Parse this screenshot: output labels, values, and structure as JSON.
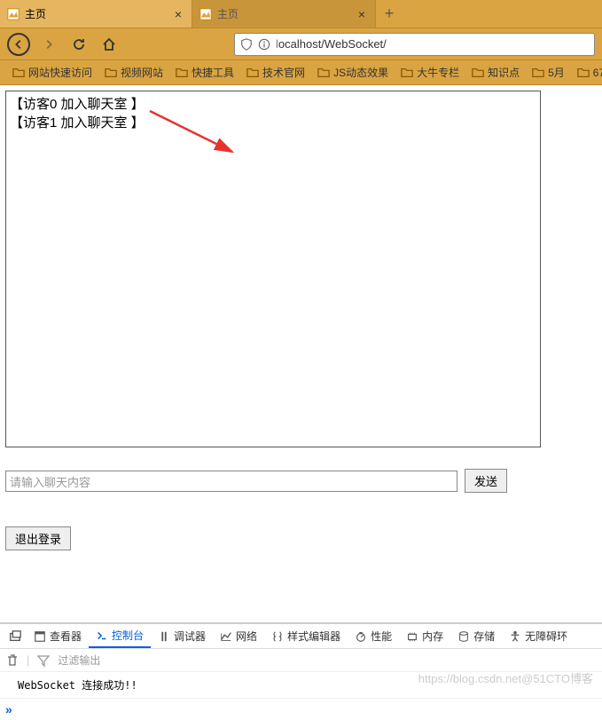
{
  "tabs": [
    {
      "title": "主页",
      "active": true
    },
    {
      "title": "主页",
      "active": false
    }
  ],
  "nav": {
    "url_prefix": "l",
    "url_rest": "ocalhost/WebSocket/"
  },
  "bookmarks": [
    {
      "label": "网站快速访问"
    },
    {
      "label": "视频网站"
    },
    {
      "label": "快捷工具"
    },
    {
      "label": "技术官网"
    },
    {
      "label": "JS动态效果"
    },
    {
      "label": "大牛专栏"
    },
    {
      "label": "知识点"
    },
    {
      "label": "5月"
    },
    {
      "label": "67"
    }
  ],
  "chat": {
    "messages": [
      "【访客0 加入聊天室 】",
      "【访客1 加入聊天室 】"
    ],
    "input_placeholder": "请输入聊天内容",
    "send_label": "发送",
    "logout_label": "退出登录"
  },
  "devtools": {
    "tabs": [
      {
        "label": "查看器",
        "icon": "inspector"
      },
      {
        "label": "控制台",
        "icon": "console",
        "active": true
      },
      {
        "label": "调试器",
        "icon": "debugger"
      },
      {
        "label": "网络",
        "icon": "network"
      },
      {
        "label": "样式编辑器",
        "icon": "style"
      },
      {
        "label": "性能",
        "icon": "perf"
      },
      {
        "label": "内存",
        "icon": "memory"
      },
      {
        "label": "存储",
        "icon": "storage"
      },
      {
        "label": "无障碍环",
        "icon": "a11y"
      }
    ],
    "filter_placeholder": "过滤输出",
    "console_lines": [
      "WebSocket 连接成功!!"
    ],
    "prompt": "»"
  },
  "watermark": "https://blog.csdn.net@51CTO博客"
}
